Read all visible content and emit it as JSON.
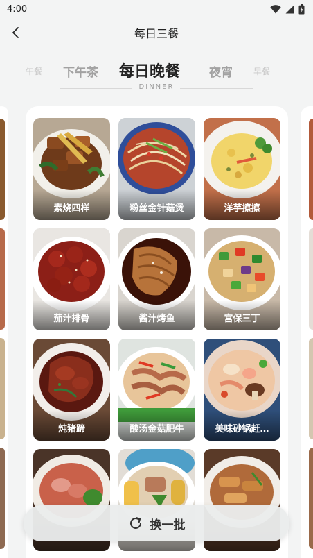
{
  "status": {
    "time": "4:00",
    "icons": [
      "wifi-icon",
      "signal-icon",
      "battery-icon"
    ]
  },
  "header": {
    "back_icon": "chevron-left-icon",
    "title": "每日三餐"
  },
  "meal_tabs": [
    {
      "label": "午餐",
      "state": "far"
    },
    {
      "label": "下午茶",
      "state": "near"
    },
    {
      "label": "每日晚餐",
      "state": "active"
    },
    {
      "label": "夜宵",
      "state": "near"
    },
    {
      "label": "早餐",
      "state": "far"
    }
  ],
  "subtitle": "DINNER",
  "dishes": [
    {
      "name": "素烧四样"
    },
    {
      "name": "粉丝金针菇煲"
    },
    {
      "name": "洋芋擦擦"
    },
    {
      "name": "茄汁排骨"
    },
    {
      "name": "酱汁烤鱼"
    },
    {
      "name": "宫保三丁"
    },
    {
      "name": "炖猪蹄"
    },
    {
      "name": "酸汤金菇肥牛"
    },
    {
      "name": "美味砂锅赶…"
    },
    {
      "name": ""
    },
    {
      "name": ""
    },
    {
      "name": ""
    }
  ],
  "refresh": {
    "icon": "refresh-icon",
    "label": "换一批"
  },
  "colors": {
    "background": "#f3f4f4",
    "card": "#ffffff",
    "active_tab": "#222222",
    "inactive_tab": "#a2a2a2"
  }
}
